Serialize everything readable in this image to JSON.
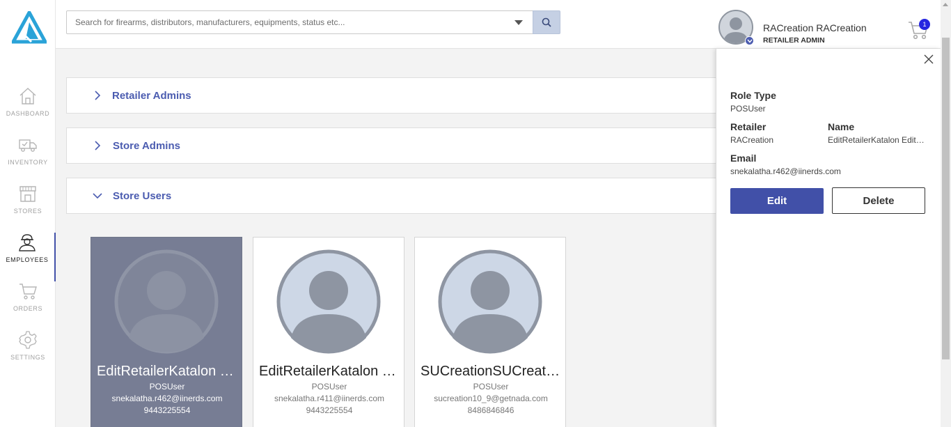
{
  "search": {
    "placeholder": "Search for firearms, distributors, manufacturers, equipments, status etc..."
  },
  "user": {
    "name": "RACreation RACreation",
    "role": "RETAILER ADMIN"
  },
  "cart": {
    "count": "1"
  },
  "sidebar": {
    "items": [
      {
        "label": "DASHBOARD",
        "icon": "home-icon",
        "active": false
      },
      {
        "label": "INVENTORY",
        "icon": "truck-icon",
        "active": false
      },
      {
        "label": "STORES",
        "icon": "store-icon",
        "active": false
      },
      {
        "label": "EMPLOYEES",
        "icon": "employee-icon",
        "active": true
      },
      {
        "label": "ORDERS",
        "icon": "cart-icon",
        "active": false
      },
      {
        "label": "SETTINGS",
        "icon": "gear-icon",
        "active": false
      }
    ]
  },
  "sections": [
    {
      "title": "Retailer Admins",
      "expanded": false
    },
    {
      "title": "Store Admins",
      "expanded": false
    },
    {
      "title": "Store Users",
      "expanded": true
    }
  ],
  "users": [
    {
      "name": "EditRetailerKatalon EditRetailerKatalon",
      "role": "POSUser",
      "email": "snekalatha.r462@iinerds.com",
      "phone": "9443225554",
      "selected": true
    },
    {
      "name": "EditRetailerKatalon EditRetailerKatalon",
      "role": "POSUser",
      "email": "snekalatha.r411@iinerds.com",
      "phone": "9443225554",
      "selected": false
    },
    {
      "name": "SUCreationSUCreation SUCreation",
      "role": "POSUser",
      "email": "sucreation10_9@getnada.com",
      "phone": "8486846846",
      "selected": false
    }
  ],
  "detail": {
    "role_type_label": "Role Type",
    "role_type": "POSUser",
    "retailer_label": "Retailer",
    "retailer": "RACreation",
    "name_label": "Name",
    "name": "EditRetailerKatalon EditRetailerKatalon",
    "email_label": "Email",
    "email": "snekalatha.r462@iinerds.com",
    "edit_label": "Edit",
    "delete_label": "Delete"
  },
  "colors": {
    "accent": "#4150a8",
    "section_title": "#4b5cb0",
    "selected_card": "#777d94",
    "cart_badge": "#2626e0"
  }
}
